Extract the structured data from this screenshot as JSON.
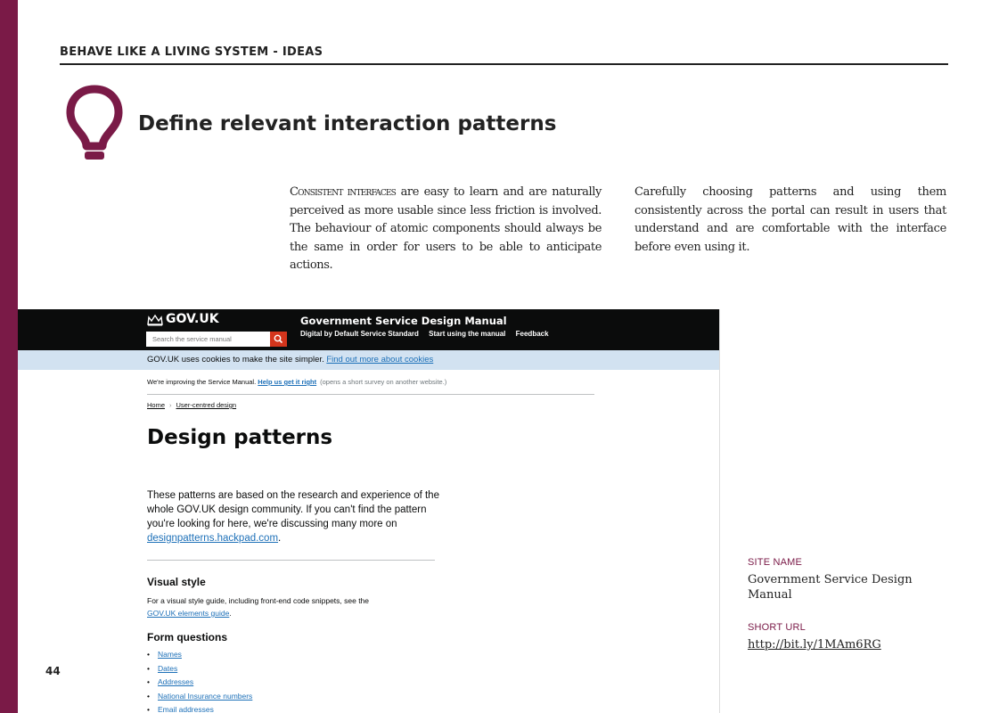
{
  "colors": {
    "accent": "#7a1a47",
    "gov_black": "#0b0c0c",
    "gov_link": "#1d70b8",
    "cookie_bg": "#d2e2f1",
    "search_red": "#d4351c"
  },
  "section_title": "BEHAVE LIKE A LIVING SYSTEM - IDEAS",
  "icon": "lightbulb-icon",
  "heading": "Define relevant interaction patterns",
  "col1": {
    "lead": "Consistent interfaces",
    "body": " are easy to learn and are naturally perceived as more usable since less friction is involved. The behaviour of atomic components should always be the same in order for users to be able to anticipate actions."
  },
  "col2": "Carefully choosing patterns and using them consistently across the portal can result in users that understand and are comfortable with the interface before even using it.",
  "screenshot": {
    "logo": "GOV.UK",
    "search_placeholder": "Search the service manual",
    "site_title": "Government Service Design Manual",
    "nav": [
      "Digital by Default Service Standard",
      "Start using the manual",
      "Feedback"
    ],
    "cookie_text": "GOV.UK uses cookies to make the site simpler.",
    "cookie_link": "Find out more about cookies",
    "survey_text": "We're improving the Service Manual.",
    "survey_link": "Help us get it right",
    "survey_note": "(opens a short survey on another website.)",
    "breadcrumbs": [
      "Home",
      "User-centred design"
    ],
    "page_title": "Design patterns",
    "intro_text": "These patterns are based on the research and experience of the whole GOV.UK design community. If you can't find the pattern you're looking for here, we're discussing many more on ",
    "intro_link": "designpatterns.hackpad.com",
    "intro_end": ".",
    "visual_style_heading": "Visual style",
    "visual_style_text": "For a visual style guide, including front-end code snippets, see the ",
    "visual_style_link": "GOV.UK elements guide",
    "visual_style_end": ".",
    "form_questions_heading": "Form questions",
    "form_questions": [
      "Names",
      "Dates",
      "Addresses",
      "National Insurance numbers",
      "Email addresses"
    ]
  },
  "meta": {
    "site_name_label": "SITE NAME",
    "site_name": "Government Service Design Manual",
    "short_url_label": "SHORT URL",
    "short_url": "http://bit.ly/1MAm6RG"
  },
  "page_number": "44"
}
